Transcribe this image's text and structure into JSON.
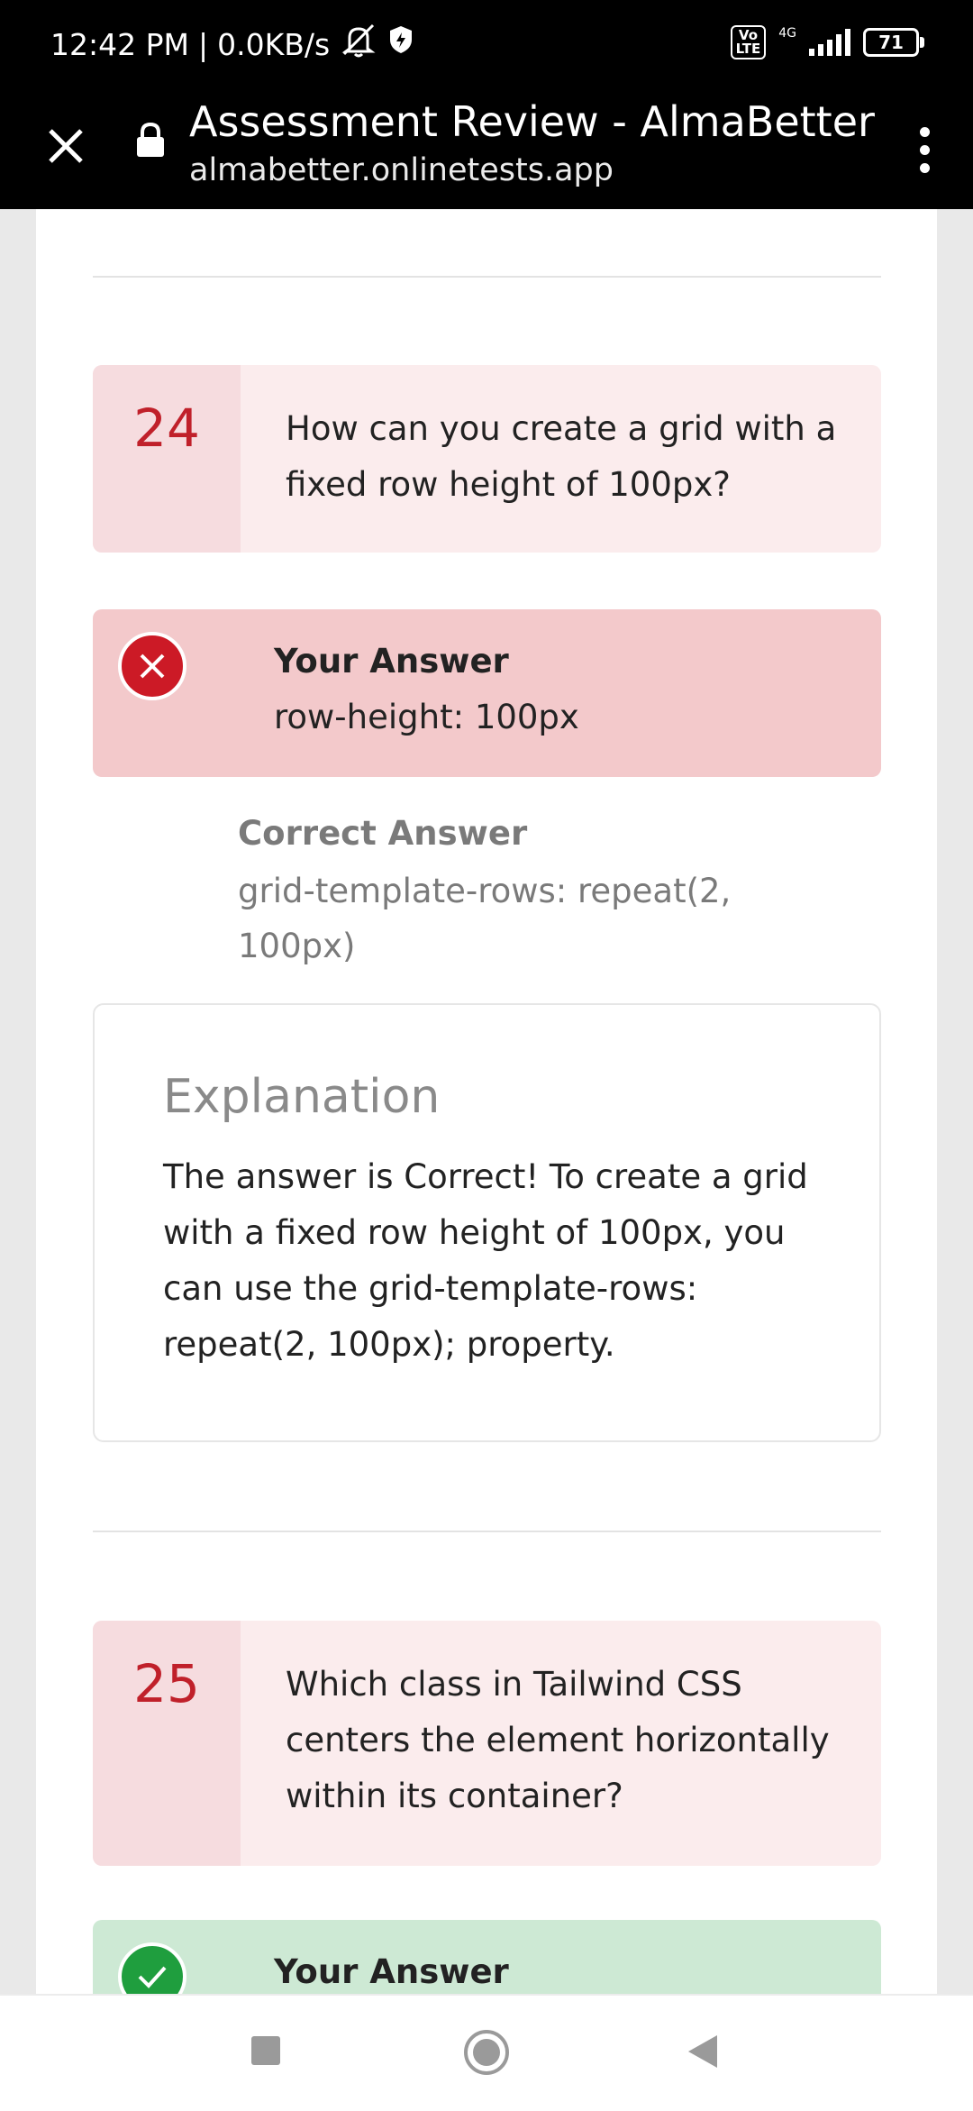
{
  "status_bar": {
    "time": "12:42 PM",
    "separator": "|",
    "speed": "0.0KB/s",
    "volte": "Vo\nLTE",
    "network": "4G",
    "battery": "71"
  },
  "browser": {
    "title": "Assessment Review - AlmaBetter",
    "url": "almabetter.onlinetests.app"
  },
  "questions": [
    {
      "number": "24",
      "text": "How can you create a grid with a fixed row height of 100px?",
      "your_answer_label": "Your Answer",
      "your_answer": "row-height: 100px",
      "correct_answer_label": "Correct Answer",
      "correct_answer": "grid-template-rows: repeat(2, 100px)",
      "explanation_title": "Explanation",
      "explanation": "The answer is Correct! To create a grid with a fixed row height of 100px, you can use the grid-template-rows: repeat(2, 100px); property."
    },
    {
      "number": "25",
      "text": "Which class in Tailwind CSS centers the element horizontally within its container?",
      "your_answer_label": "Your Answer"
    }
  ],
  "colors": {
    "wrong": "#cc1a26",
    "correct": "#1f9e3e",
    "question_number": "#c0202a"
  }
}
